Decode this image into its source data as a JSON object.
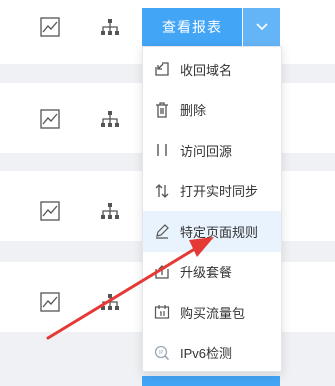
{
  "toolbar": {
    "report_label": "查看报表",
    "dropdown_icon": "chevron-down-icon"
  },
  "row_icons": [
    "trend-chart-icon",
    "sitemap-icon"
  ],
  "menu": {
    "items": [
      {
        "label": "收回域名",
        "icon": "reclaim-icon"
      },
      {
        "label": "删除",
        "icon": "trash-icon"
      },
      {
        "label": "访问回源",
        "icon": "origin-icon"
      },
      {
        "label": "打开实时同步",
        "icon": "sync-icon"
      },
      {
        "label": "特定页面规则",
        "icon": "edit-icon",
        "active": true
      },
      {
        "label": "升级套餐",
        "icon": "upgrade-icon"
      },
      {
        "label": "购买流量包",
        "icon": "traffic-pack-icon"
      },
      {
        "label": "IPv6检测",
        "icon": "ipv6-detect-icon"
      }
    ]
  },
  "colors": {
    "primary": "#43a5f5",
    "menu_active_bg": "#e8f3fd",
    "annotation_arrow": "#e53935"
  }
}
